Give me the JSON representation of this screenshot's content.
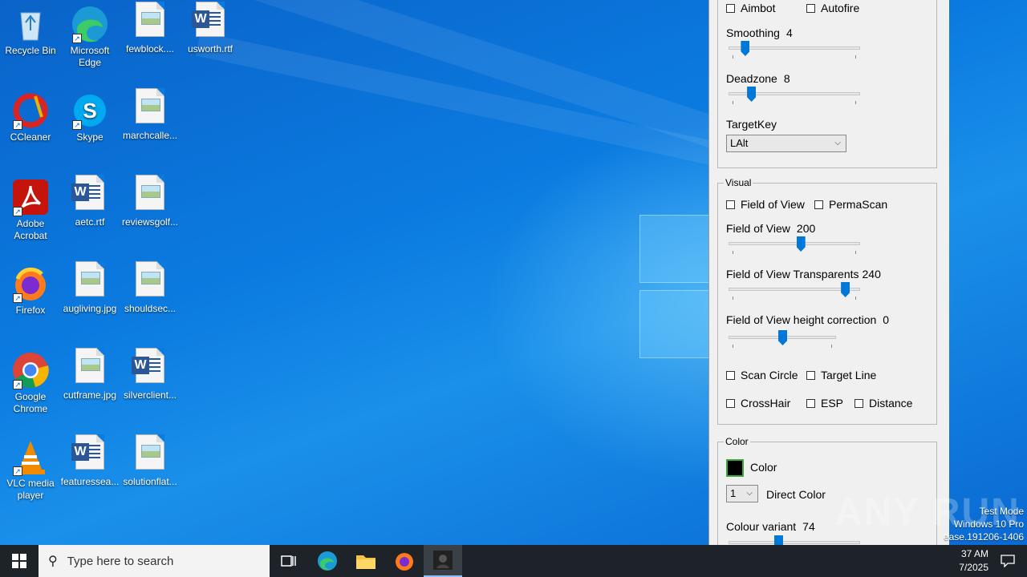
{
  "desktop_icons": [
    {
      "label": "Recycle Bin",
      "icon": "recycle-bin-icon"
    },
    {
      "label": "Microsoft Edge",
      "icon": "edge-icon"
    },
    {
      "label": "fewblock....",
      "icon": "image-file-icon"
    },
    {
      "label": "usworth.rtf",
      "icon": "word-file-icon"
    },
    {
      "label": "CCleaner",
      "icon": "ccleaner-icon"
    },
    {
      "label": "Skype",
      "icon": "skype-icon"
    },
    {
      "label": "marchcalle...",
      "icon": "image-file-icon"
    },
    {
      "label": "Adobe Acrobat",
      "icon": "acrobat-icon"
    },
    {
      "label": "aetc.rtf",
      "icon": "word-file-icon"
    },
    {
      "label": "reviewsgolf...",
      "icon": "image-file-icon"
    },
    {
      "label": "Firefox",
      "icon": "firefox-icon"
    },
    {
      "label": "augliving.jpg",
      "icon": "image-file-icon"
    },
    {
      "label": "shouldsec...",
      "icon": "image-file-icon"
    },
    {
      "label": "Google Chrome",
      "icon": "chrome-icon"
    },
    {
      "label": "cutframe.jpg",
      "icon": "image-file-icon"
    },
    {
      "label": "silverclient...",
      "icon": "word-file-icon"
    },
    {
      "label": "VLC media player",
      "icon": "vlc-icon"
    },
    {
      "label": "featuressea...",
      "icon": "word-file-icon"
    },
    {
      "label": "solutionflat...",
      "icon": "image-file-icon"
    }
  ],
  "panel": {
    "aim": {
      "aimbot": "Aimbot",
      "autofire": "Autofire",
      "smoothing_label": "Smoothing",
      "smoothing_value": "4",
      "smoothing_fraction": 0.1,
      "deadzone_label": "Deadzone",
      "deadzone_value": "8",
      "deadzone_fraction": 0.15,
      "targetkey_label": "TargetKey",
      "targetkey_value": "LAlt"
    },
    "visual": {
      "title": "Visual",
      "fov_check": "Field of View",
      "permascan": "PermaScan",
      "fov_label": "Field of View",
      "fov_value": "200",
      "fov_fraction": 0.55,
      "fov_trans_label": "Field of View Transparents",
      "fov_trans_value": "240",
      "fov_trans_fraction": 0.91,
      "fov_height_label": "Field of View height correction",
      "fov_height_value": "0",
      "fov_height_fraction": 0.5,
      "scan_circle": "Scan Circle",
      "target_line": "Target Line",
      "crosshair": "CrossHair",
      "esp": "ESP",
      "distance": "Distance"
    },
    "color": {
      "title": "Color",
      "color_label": "Color",
      "swatch": "#000000",
      "direct_select": "1",
      "direct_label": "Direct Color",
      "variant_label": "Colour variant",
      "variant_value": "74",
      "variant_fraction": 0.37
    }
  },
  "system": {
    "watermark": "ANY RUN",
    "test_mode": "Test Mode",
    "os": "Windows 10 Pro",
    "build": "ease.191206-1406",
    "time": "37 AM",
    "date": "7/2025"
  },
  "taskbar": {
    "search_placeholder": "Type here to search"
  }
}
